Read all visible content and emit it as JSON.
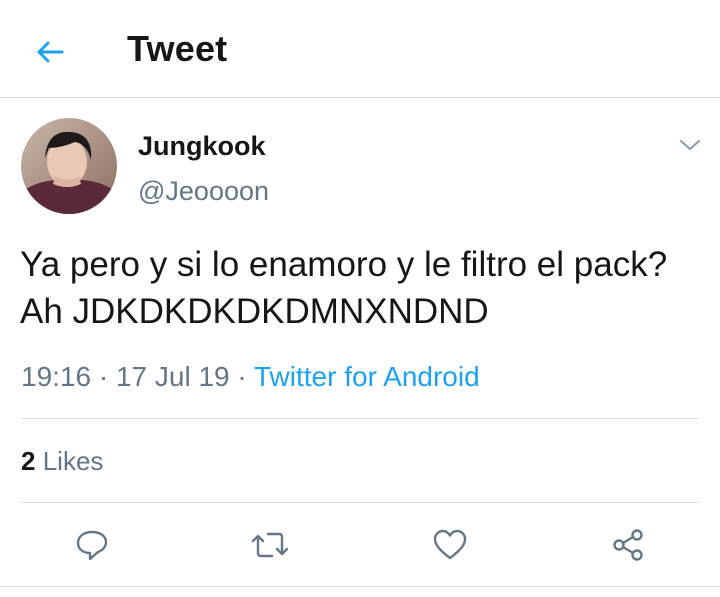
{
  "header": {
    "title": "Tweet",
    "back_icon": "arrow-left-icon",
    "accent": "#1da1f2"
  },
  "tweet": {
    "display_name": "Jungkook",
    "handle": "@Jeoooon",
    "text": "Ya pero y si lo enamoro y le filtro el pack? Ah JDKDKDKDKDMNXNDND",
    "time": "19:16",
    "separator": "·",
    "date": "17 Jul 19",
    "source": "Twitter for Android",
    "likes_count": "2",
    "likes_label": "Likes"
  },
  "actions": [
    {
      "name": "reply",
      "icon": "reply-bubble-icon"
    },
    {
      "name": "retweet",
      "icon": "retweet-icon"
    },
    {
      "name": "like",
      "icon": "heart-icon"
    },
    {
      "name": "share",
      "icon": "share-icon"
    }
  ],
  "colors": {
    "text": "#14171a",
    "muted": "#657786",
    "divider": "#d9dee2",
    "link": "#1da1f2"
  }
}
